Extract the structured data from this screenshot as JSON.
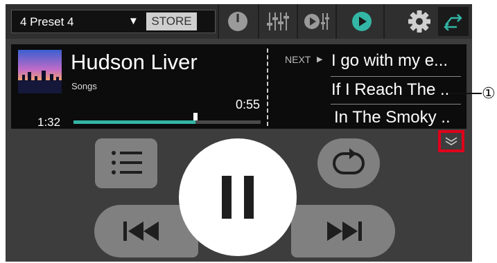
{
  "header": {
    "preset": "4 Preset 4",
    "preset_caret": "▼",
    "store_label": "STORE"
  },
  "now_playing": {
    "title": "Hudson Liver",
    "album": "Songs",
    "elapsed": "1:32",
    "remaining": "0:55",
    "progress": 0.65
  },
  "queue": {
    "next_label": "NEXT",
    "next_arrow": "▶",
    "items": [
      "I go with my e...",
      "If I Reach The ..",
      "In The Smoky .."
    ]
  },
  "annotation": {
    "marker": "①"
  },
  "colors": {
    "accent": "#33b6a6",
    "highlight": "#e0001b"
  }
}
